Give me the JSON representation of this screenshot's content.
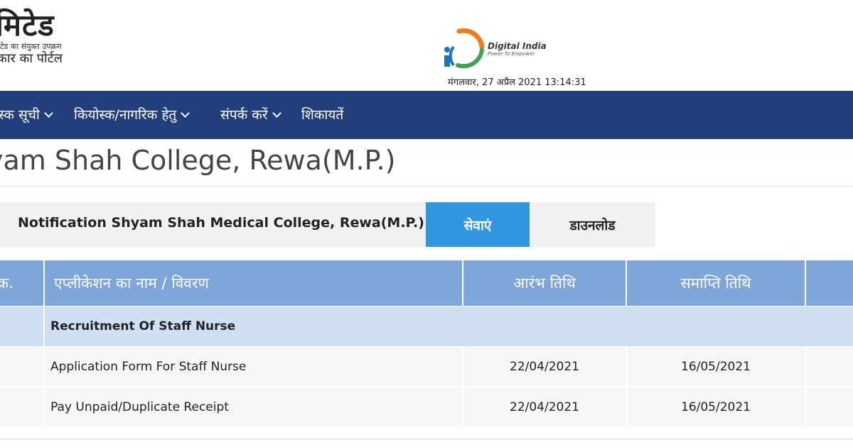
{
  "header": {
    "logo_title": "मिटेड",
    "logo_sub1": "टेड का संयुक्त उपक्रम",
    "logo_sub2": "कार का पोर्टल",
    "digital_india_brand": "Digital India",
    "digital_india_tagline": "Power To Empower",
    "datetime": "मंगलवार, 27 अप्रैल 2021 13:14:31"
  },
  "nav": {
    "items": [
      {
        "label": "स्क सूची"
      },
      {
        "label": "कियोस्क/नागरिक हेतु"
      },
      {
        "label": "संपर्क करें"
      },
      {
        "label": "शिकायतें"
      }
    ]
  },
  "page": {
    "title": "yam Shah College, Rewa(M.P.)"
  },
  "tabs": {
    "notification": "Notification Shyam Shah Medical College, Rewa(M.P.)",
    "services": "सेवाएं",
    "download": "डाउनलोड"
  },
  "table": {
    "headers": {
      "sno": "क्र.",
      "name": "एप्लीकेशन का नाम / विवरण",
      "start": "आरंभ तिथि",
      "end": "समाप्ति तिथि"
    },
    "group": "Recruitment Of Staff Nurse",
    "rows": [
      {
        "name": "Application Form For Staff Nurse",
        "start": "22/04/2021",
        "end": "16/05/2021"
      },
      {
        "name": "Pay Unpaid/Duplicate Receipt",
        "start": "22/04/2021",
        "end": "16/05/2021"
      }
    ]
  },
  "colors": {
    "nav_bg": "#233f7b",
    "tab_active": "#3097e0",
    "table_header": "#7ea6d9",
    "group_row": "#cfe0f5"
  },
  "icons": {
    "nav_dropdown": "chevron-down-icon",
    "digital_india": "digital-india-logo"
  }
}
